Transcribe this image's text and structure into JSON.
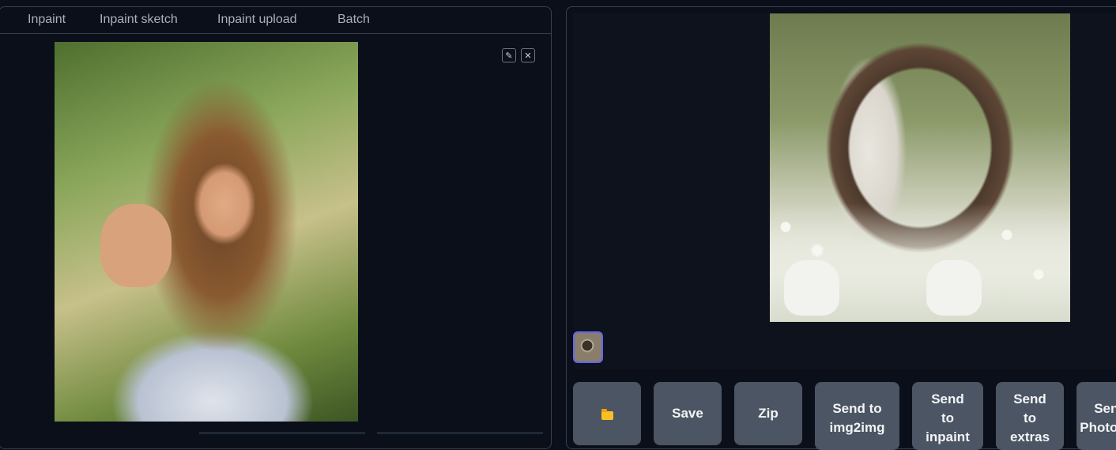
{
  "left_panel": {
    "tabs": [
      {
        "label": "Inpaint"
      },
      {
        "label": "Inpaint sketch"
      },
      {
        "label": "Inpaint upload"
      },
      {
        "label": "Batch"
      }
    ],
    "edit_icon": "✎",
    "clear_icon": "✕"
  },
  "right_panel": {
    "buttons": {
      "open_folder_icon": "folder-icon",
      "save": "Save",
      "zip": "Zip",
      "send_img2img": [
        "Send to",
        "img2img"
      ],
      "send_inpaint": [
        "Send",
        "to",
        "inpaint"
      ],
      "send_extras": [
        "Send",
        "to",
        "extras"
      ],
      "send_photopea": [
        "Send",
        "Photopea"
      ]
    }
  }
}
